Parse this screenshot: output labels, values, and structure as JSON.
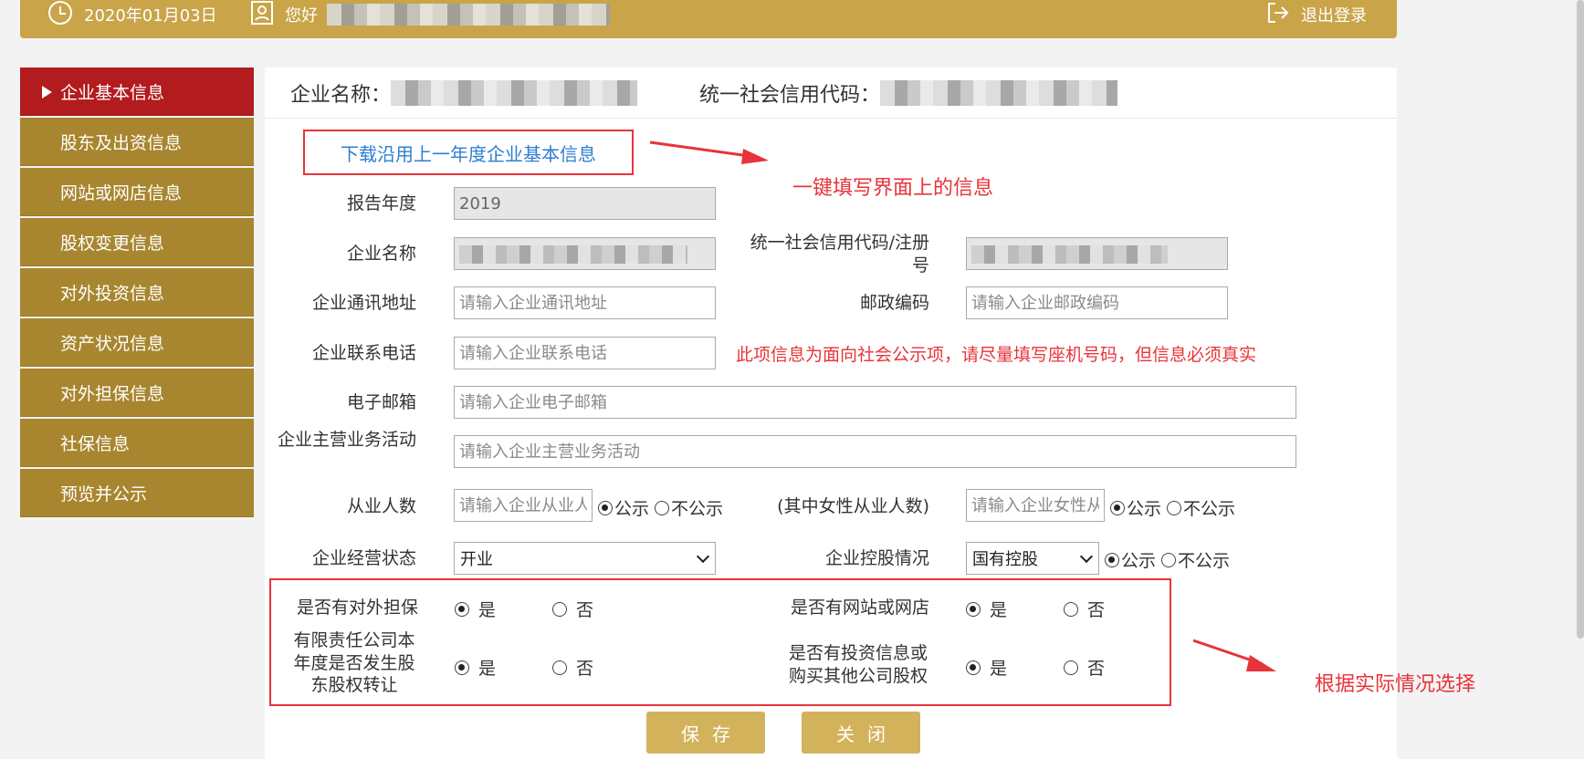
{
  "header": {
    "date": "2020年01月03日",
    "greeting": "您好",
    "logout": "退出登录"
  },
  "sidebar": {
    "items": [
      {
        "label": "企业基本信息",
        "active": true
      },
      {
        "label": "股东及出资信息"
      },
      {
        "label": "网站或网店信息"
      },
      {
        "label": "股权变更信息"
      },
      {
        "label": "对外投资信息"
      },
      {
        "label": "资产状况信息"
      },
      {
        "label": "对外担保信息"
      },
      {
        "label": "社保信息"
      },
      {
        "label": "预览并公示"
      }
    ]
  },
  "panel": {
    "company_name_label": "企业名称：",
    "credit_code_label": "统一社会信用代码：",
    "download_link": "下载沿用上一年度企业基本信息",
    "annotation_fill": "一键填写界面上的信息",
    "annotation_phone": "此项信息为面向社会公示项，请尽量填写座机号码，但信息必须真实",
    "annotation_choose": "根据实际情况选择"
  },
  "form": {
    "report_year": {
      "label": "报告年度",
      "value": "2019"
    },
    "company_name": {
      "label": "企业名称"
    },
    "credit_code": {
      "label": "统一社会信用代码/注册号"
    },
    "address": {
      "label": "企业通讯地址",
      "placeholder": "请输入企业通讯地址"
    },
    "postcode": {
      "label": "邮政编码",
      "placeholder": "请输入企业邮政编码"
    },
    "phone": {
      "label": "企业联系电话",
      "placeholder": "请输入企业联系电话"
    },
    "email": {
      "label": "电子邮箱",
      "placeholder": "请输入企业电子邮箱"
    },
    "business": {
      "label": "企业主营业务活动",
      "placeholder": "请输入企业主营业务活动"
    },
    "employees": {
      "label": "从业人数",
      "placeholder": "请输入企业从业人"
    },
    "female_employees": {
      "label": "(其中女性从业人数)",
      "placeholder": "请输入企业女性从"
    },
    "status": {
      "label": "企业经营状态",
      "value": "开业"
    },
    "holding": {
      "label": "企业控股情况",
      "value": "国有控股"
    },
    "public": "公示",
    "not_public": "不公示",
    "guarantee": {
      "label": "是否有对外担保"
    },
    "website": {
      "label": "是否有网站或网店"
    },
    "transfer": {
      "label": "有限责任公司本年度是否发生股东股权转让"
    },
    "invest": {
      "label": "是否有投资信息或购买其他公司股权"
    },
    "yes": "是",
    "no": "否"
  },
  "buttons": {
    "save": "保存",
    "close": "关闭"
  },
  "colors": {
    "header_gold": "#c9a449",
    "sidebar_gold": "#a8862f",
    "active_red": "#b21c1f",
    "annotation_red": "#e8333a",
    "link_blue": "#2d7fd3",
    "button_gold": "#d3b25c"
  }
}
